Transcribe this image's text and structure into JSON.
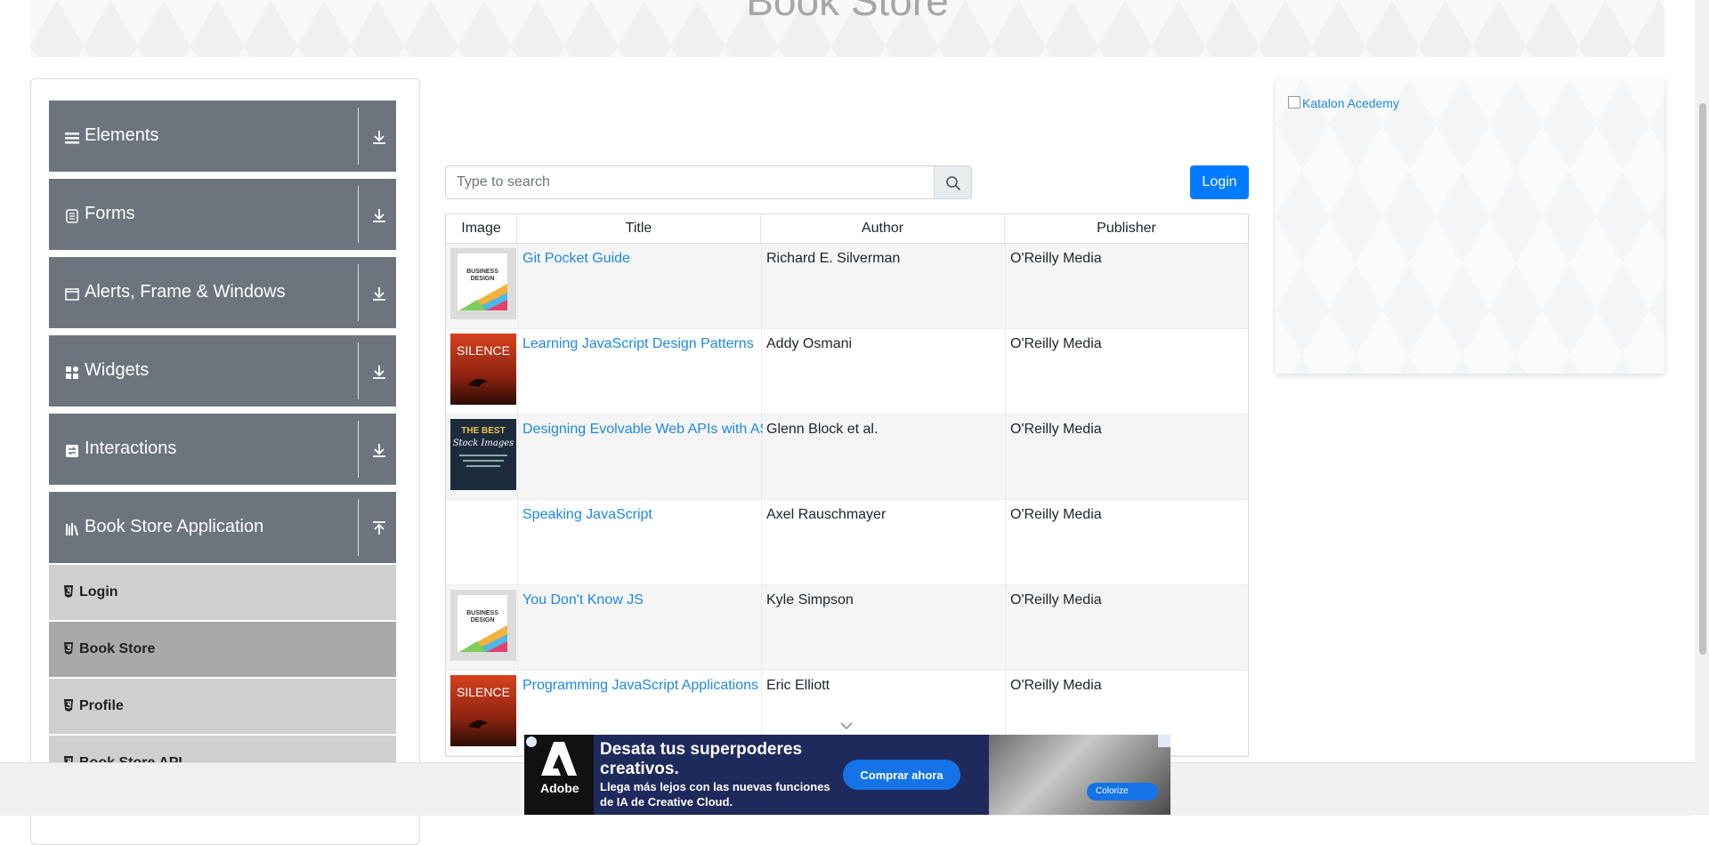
{
  "header": {
    "title": "Book Store"
  },
  "sidebar": {
    "groups": [
      {
        "label": "Elements",
        "icon": "hamburger-icon",
        "expanded": false
      },
      {
        "label": "Forms",
        "icon": "form-icon",
        "expanded": false
      },
      {
        "label": "Alerts, Frame & Windows",
        "icon": "window-icon",
        "expanded": false
      },
      {
        "label": "Widgets",
        "icon": "widgets-icon",
        "expanded": false
      },
      {
        "label": "Interactions",
        "icon": "interactions-icon",
        "expanded": false
      },
      {
        "label": "Book Store Application",
        "icon": "books-icon",
        "expanded": true
      }
    ],
    "subitems": [
      {
        "label": "Login",
        "active": false
      },
      {
        "label": "Book Store",
        "active": true
      },
      {
        "label": "Profile",
        "active": false
      },
      {
        "label": "Book Store API",
        "active": false
      }
    ]
  },
  "search": {
    "placeholder": "Type to search",
    "value": ""
  },
  "login_button": "Login",
  "table": {
    "headers": [
      "Image",
      "Title",
      "Author",
      "Publisher"
    ],
    "rows": [
      {
        "cover": "business-design",
        "title": "Git Pocket Guide",
        "author": "Richard E. Silverman",
        "publisher": "O'Reilly Media"
      },
      {
        "cover": "silence",
        "title": "Learning JavaScript Design Patterns",
        "author": "Addy Osmani",
        "publisher": "O'Reilly Media"
      },
      {
        "cover": "best-stock",
        "title": "Designing Evolvable Web APIs with ASP.NET",
        "author": "Glenn Block et al.",
        "publisher": "O'Reilly Media"
      },
      {
        "cover": "none",
        "title": "Speaking JavaScript",
        "author": "Axel Rauschmayer",
        "publisher": "O'Reilly Media"
      },
      {
        "cover": "business-design",
        "title": "You Don't Know JS",
        "author": "Kyle Simpson",
        "publisher": "O'Reilly Media"
      },
      {
        "cover": "silence",
        "title": "Programming JavaScript Applications",
        "author": "Eric Elliott",
        "publisher": "O'Reilly Media"
      }
    ]
  },
  "side_ad": {
    "alt": "Katalon Acedemy"
  },
  "bottom_ad": {
    "brand": "Adobe",
    "headline": "Desata tus superpoderes creativos.",
    "subline": "Llega más lejos con las nuevas funciones de IA de Creative Cloud.",
    "cta": "Comprar ahora",
    "pill": "Colorize"
  },
  "colors": {
    "sidebar_group": "#6c757d",
    "primary": "#007bff",
    "link": "#1e88e5"
  }
}
